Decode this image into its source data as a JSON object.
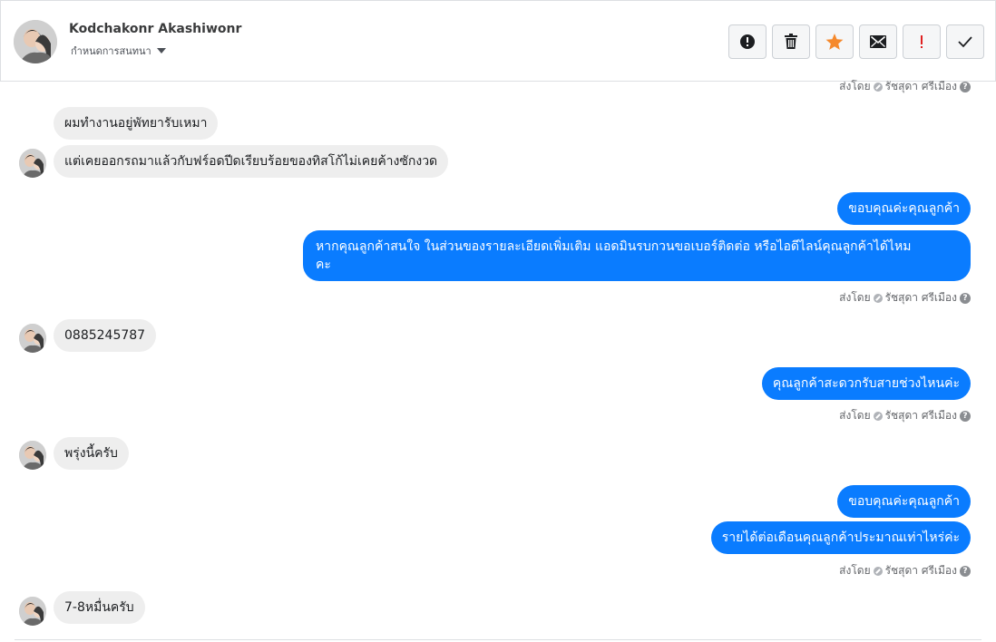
{
  "header": {
    "name": "Kodchakonr Akashiwonr",
    "subtitle": "กำหนดการสนทนา"
  },
  "actions": [
    {
      "id": "alert",
      "icon": "alert-circle-icon",
      "color": "#1c1e21"
    },
    {
      "id": "delete",
      "icon": "trash-icon",
      "color": "#1c1e21"
    },
    {
      "id": "star",
      "icon": "star-icon",
      "color": "#f5892c"
    },
    {
      "id": "email",
      "icon": "envelope-icon",
      "color": "#1c1e21"
    },
    {
      "id": "important",
      "icon": "exclamation-icon",
      "color": "#e02020"
    },
    {
      "id": "done",
      "icon": "check-icon",
      "color": "#1c1e21"
    }
  ],
  "sent_by_label": "ส่งโดย",
  "sender_name": "รัชสุดา ศรีเมือง",
  "messages": {
    "m1": "ผมทำงานอยู่พัทยารับเหมา",
    "m2": "แต่เคยออกรถมาแล้วกับฟร์อดปีดเรียบร้อยของทิสโก้ไม่เคยค้างซักงวด",
    "m3": "ขอบคุณค่ะคุณลูกค้า",
    "m4_line1": "หากคุณลูกค้าสนใจ ในส่วนของรายละเอียดเพิ่มเติม แอดมินรบกวนขอเบอร์ติดต่อ หรือไอดีไลน์คุณลูกค้าได้ไหม",
    "m4_line2": "คะ",
    "m5": "0885245787",
    "m6": "คุณลูกค้าสะดวกรับสายช่วงไหนค่ะ",
    "m7": "พรุ่งนี้ครับ",
    "m8": "ขอบคุณค่ะคุณลูกค้า",
    "m9": "รายได้ต่อเดือนคุณลูกค้าประมาณเท่าไหร่ค่ะ",
    "m10": "7-8หมื่นครับ"
  },
  "colors": {
    "outgoing": "#0a7cff",
    "incoming": "#eeeeee"
  }
}
